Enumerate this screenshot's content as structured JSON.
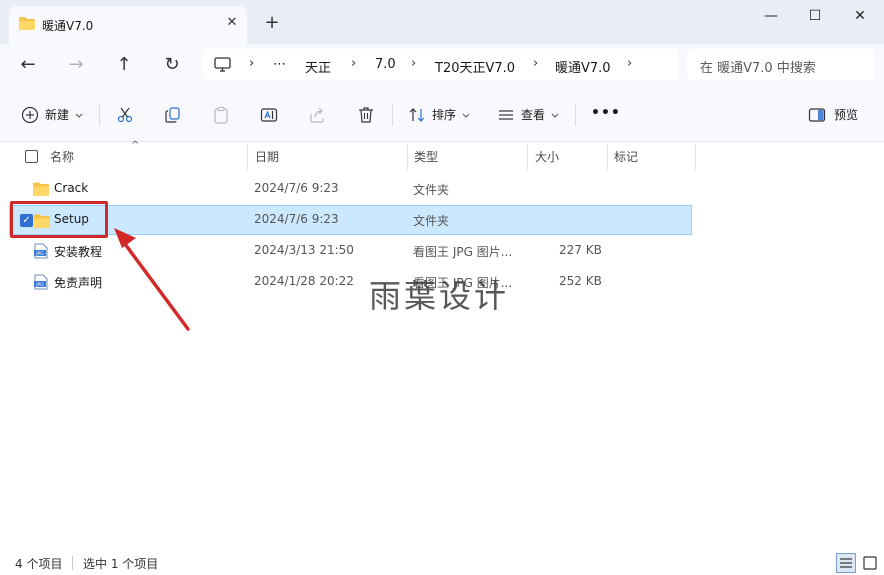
{
  "tab": {
    "title": "暖通V7.0",
    "close": "✕",
    "new_tab": "+"
  },
  "window": {
    "minimize": "—",
    "maximize": "☐",
    "close": "✕"
  },
  "nav": {
    "back": "←",
    "forward": "→",
    "up": "↑",
    "refresh": "↻"
  },
  "address": {
    "more": "⋯",
    "segments": [
      "天正",
      "7.0",
      "T20天正V7.0",
      "暖通V7.0"
    ],
    "separator": "›"
  },
  "search": {
    "placeholder": "在 暖通V7.0 中搜索"
  },
  "toolbar": {
    "new_label": "新建",
    "sort_label": "排序",
    "view_label": "查看",
    "more": "•••",
    "preview_label": "预览"
  },
  "columns": {
    "name": "名称",
    "date": "日期",
    "type": "类型",
    "size": "大小",
    "tags": "标记"
  },
  "files": [
    {
      "name": "Crack",
      "date": "2024/7/6 9:23",
      "type": "文件夹",
      "size": "",
      "icon": "folder-icon",
      "selected": false
    },
    {
      "name": "Setup",
      "date": "2024/7/6 9:23",
      "type": "文件夹",
      "size": "",
      "icon": "folder-icon",
      "selected": true
    },
    {
      "name": "安装教程",
      "date": "2024/3/13 21:50",
      "type": "看图王 JPG 图片...",
      "size": "227 KB",
      "icon": "jpg-file-icon",
      "selected": false
    },
    {
      "name": "免责声明",
      "date": "2024/1/28 20:22",
      "type": "看图王 JPG 图片...",
      "size": "252 KB",
      "icon": "jpg-file-icon",
      "selected": false
    }
  ],
  "watermark": "雨葉设计",
  "status": {
    "count": "4 个项目",
    "selected": "选中 1 个项目"
  },
  "colors": {
    "accent": "#2f6fd0",
    "selection": "#cce8ff",
    "annotation": "#d22a2a",
    "folder": "#f4c34a"
  }
}
